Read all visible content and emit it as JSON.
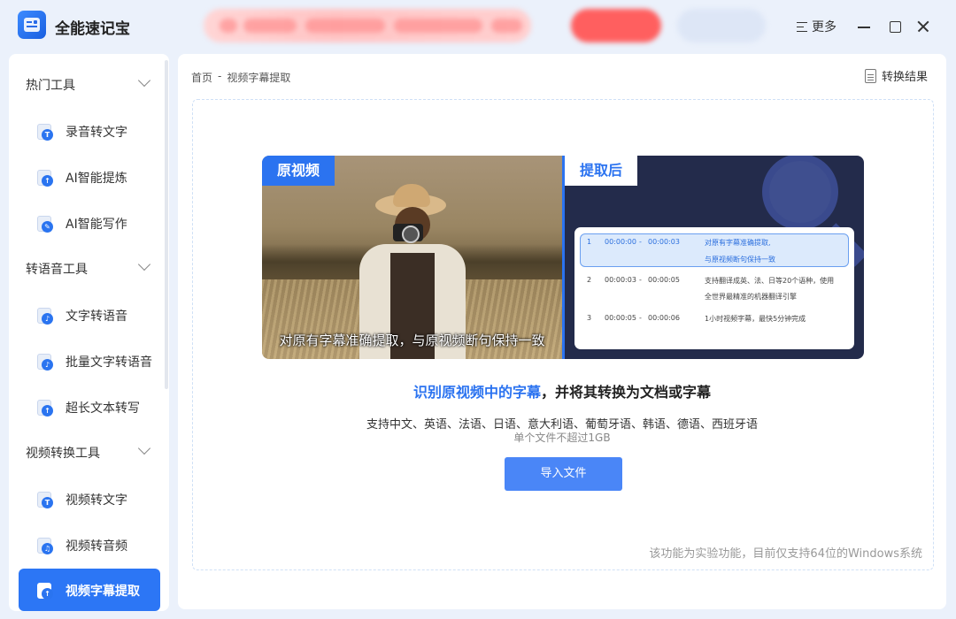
{
  "app": {
    "title": "全能速记宝",
    "logo_icon": "app-logo-icon"
  },
  "titlebar": {
    "more_label": "更多"
  },
  "sidebar": {
    "groups": [
      {
        "label": "热门工具",
        "items": [
          {
            "label": "录音转文字",
            "icon": "audio-to-text-icon"
          },
          {
            "label": "AI智能提炼",
            "icon": "ai-extract-icon"
          },
          {
            "label": "AI智能写作",
            "icon": "ai-writing-icon"
          }
        ]
      },
      {
        "label": "转语音工具",
        "items": [
          {
            "label": "文字转语音",
            "icon": "text-to-speech-icon"
          },
          {
            "label": "批量文字转语音",
            "icon": "batch-text-to-speech-icon"
          },
          {
            "label": "超长文本转写",
            "icon": "long-text-icon"
          }
        ]
      },
      {
        "label": "视频转换工具",
        "items": [
          {
            "label": "视频转文字",
            "icon": "video-to-text-icon"
          },
          {
            "label": "视频转音频",
            "icon": "video-to-audio-icon"
          },
          {
            "label": "视频字幕提取",
            "icon": "subtitle-extract-icon",
            "active": true
          }
        ]
      }
    ]
  },
  "breadcrumb": {
    "home": "首页",
    "separator": "-",
    "current": "视频字幕提取"
  },
  "header": {
    "result_label": "转换结果"
  },
  "demo": {
    "original_tag": "原视频",
    "after_tag": "提取后",
    "photo_subtitle": "对原有字幕准确提取，与原视频断句保持一致",
    "subtitles": [
      {
        "index": "1",
        "start": "00:00:00",
        "dash": "-",
        "end": "00:00:03",
        "text_line1": "对原有字幕准确提取,",
        "text_line2": "与原视频断句保持一致"
      },
      {
        "index": "2",
        "start": "00:00:03",
        "dash": "-",
        "end": "00:00:05",
        "text_line1": "支持翻译成英、法、日等20个语种，使用",
        "text_line2": "全世界最精准的机器翻译引擎"
      },
      {
        "index": "3",
        "start": "00:00:05",
        "dash": "-",
        "end": "00:00:06",
        "text_line1": "1小时视频字幕，最快5分钟完成",
        "text_line2": ""
      }
    ]
  },
  "content": {
    "headline_highlight": "识别原视频中的字幕",
    "headline_rest": "，并将其转换为文档或字幕",
    "languages": "支持中文、英语、法语、日语、意大利语、葡萄牙语、韩语、德语、西班牙语",
    "size_limit": "单个文件不超过1GB",
    "import_button": "导入文件",
    "note": "该功能为实验功能，目前仅支持64位的Windows系统"
  },
  "colors": {
    "accent": "#2c76f5",
    "button": "#4a86f7",
    "highlight_text": "#2b73f0"
  }
}
